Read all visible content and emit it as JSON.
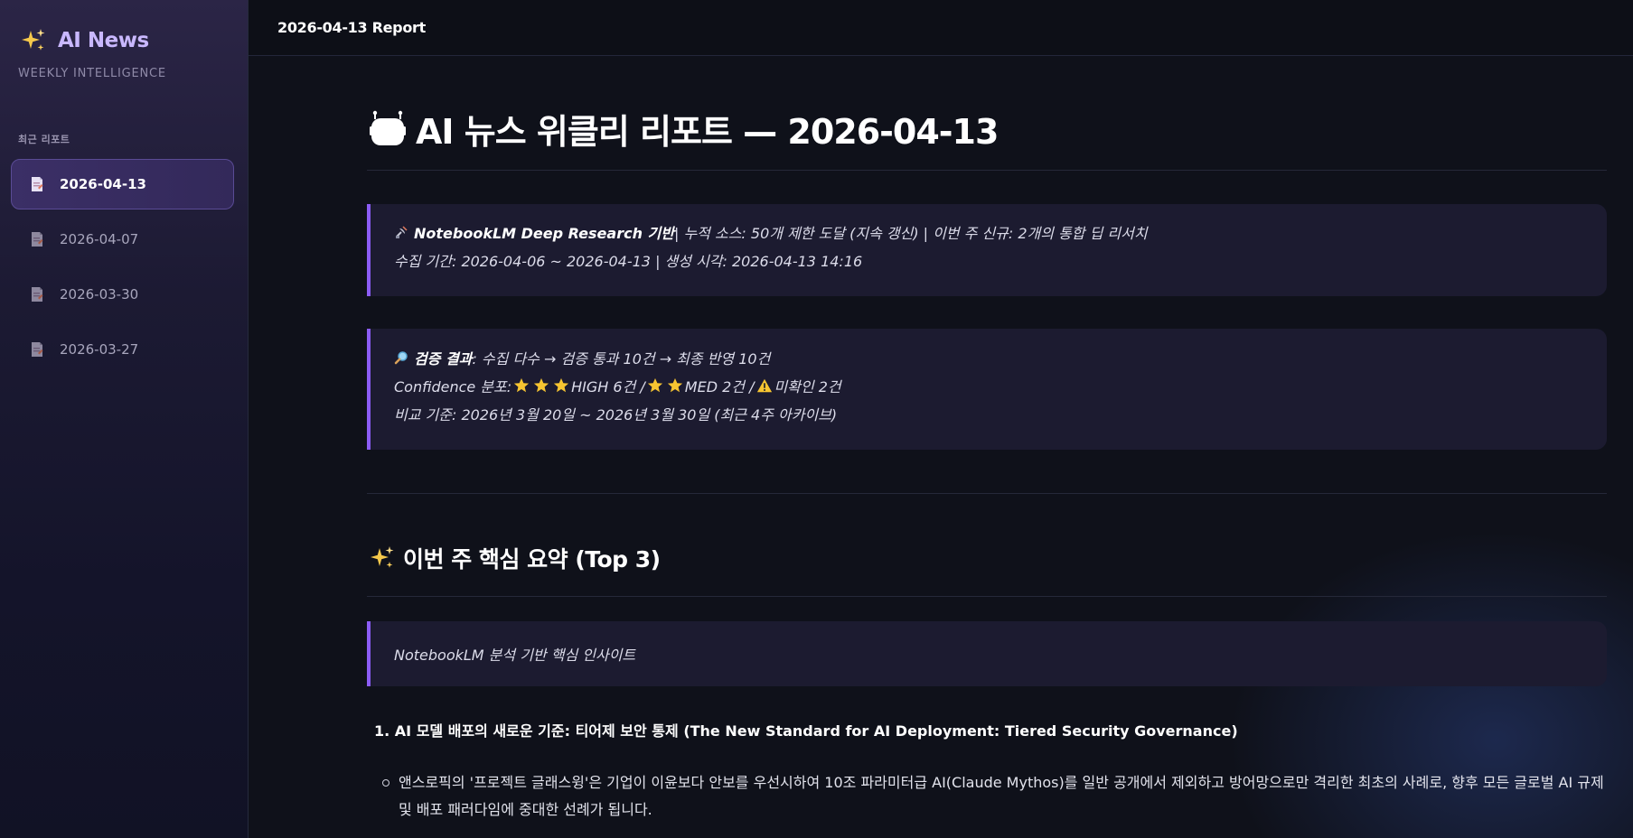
{
  "sidebar": {
    "brand_title": "AI News",
    "brand_subtitle": "WEEKLY INTELLIGENCE",
    "section_label": "최근 리포트",
    "items": [
      {
        "label": "2026-04-13",
        "active": true
      },
      {
        "label": "2026-04-07",
        "active": false
      },
      {
        "label": "2026-03-30",
        "active": false
      },
      {
        "label": "2026-03-27",
        "active": false
      }
    ]
  },
  "topbar": {
    "title": "2026-04-13 Report"
  },
  "main": {
    "title": "AI 뉴스 위클리 리포트 — 2026-04-13",
    "callout1": {
      "line1_bold": "NotebookLM Deep Research 기반",
      "line1_rest": " | 누적 소스: 50개 제한 도달 (지속 갱신) | 이번 주 신규: 2개의 통합 딥 리서치",
      "line2": "수집 기간: 2026-04-06 ~ 2026-04-13 | 생성 시각: 2026-04-13 14:16"
    },
    "callout2": {
      "line1_bold": "검증 결과",
      "line1_rest": ": 수집 다수 → 검증 통과 10건 → 최종 반영 10건",
      "line2_prefix": "Confidence 분포: ",
      "line2_high": " HIGH 6건 / ",
      "line2_med": " MED 2건 / ",
      "line2_unverified": " 미확인 2건",
      "line3": "비교 기준: 2026년 3월 20일 ~ 2026년 3월 30일 (최근 4주 아카이브)"
    },
    "section_title": "이번 주 핵심 요약 (Top 3)",
    "callout3": {
      "text": "NotebookLM 분석 기반 핵심 인사이트"
    },
    "list_item_1": "1. AI 모델 배포의 새로운 기준: 티어제 보안 통제 (The New Standard for AI Deployment: Tiered Security Governance)",
    "bullet_1": "앤스로픽의 '프로젝트 글래스윙'은 기업이 이윤보다 안보를 우선시하여 10조 파라미터급 AI(Claude Mythos)를 일반 공개에서 제외하고 방어망으로만 격리한 최초의 사례로, 향후 모든 글로벌 AI 규제 및 배포 패러다임에 중대한 선례가 됩니다."
  },
  "icons": {
    "brand": "sparkles-icon",
    "nav": "document-icon",
    "title": "robot-icon",
    "callout1": "satellite-icon",
    "callout2": "magnifier-icon",
    "section": "sparkles-icon",
    "warning": "warning-icon",
    "star": "star-icon"
  },
  "colors": {
    "accent": "#8b5cf6",
    "brand_text": "#c9b8ff",
    "background": "#0f111a"
  }
}
